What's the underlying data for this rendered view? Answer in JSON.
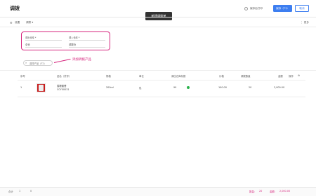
{
  "header": {
    "title": "调拨",
    "print_label": "保存后打印",
    "save_label": "保存（F1）",
    "cancel_label": "取消"
  },
  "tooltip": "新建调拨单",
  "toolbar": {
    "settings": "设置",
    "transfer": "调拨",
    "more": "更多"
  },
  "form": {
    "out_warehouse_label": "调出仓库 *",
    "in_warehouse_label": "调入仓库 *",
    "out_warehouse_value": "总仓",
    "in_warehouse_value": "调拨仓"
  },
  "search": {
    "placeholder": "选择产品（F2）"
  },
  "annotation": "添加调拨产品",
  "table": {
    "columns": [
      "序号",
      "品名（货号）",
      "规格",
      "单位",
      "调出仓库存数",
      "价格",
      "调拨数量",
      "金额",
      "操作"
    ],
    "rows": [
      {
        "index": "1",
        "name": "猫粮套餐",
        "code": "CCY00031",
        "spec": "200ml",
        "unit": "包",
        "stock": "99",
        "price": "100.00",
        "qty": "20",
        "amount": "2,000.00"
      }
    ]
  },
  "footer": {
    "total_label": "合计",
    "total_value": "1",
    "count_value": "0",
    "qty_label": "数量：",
    "qty_value": "20",
    "amount_label": "金额：",
    "amount_value": "2,000.00"
  },
  "colors": {
    "accent": "#3d7ef0",
    "annotation": "#d6247d",
    "status": "#2bb24c"
  }
}
